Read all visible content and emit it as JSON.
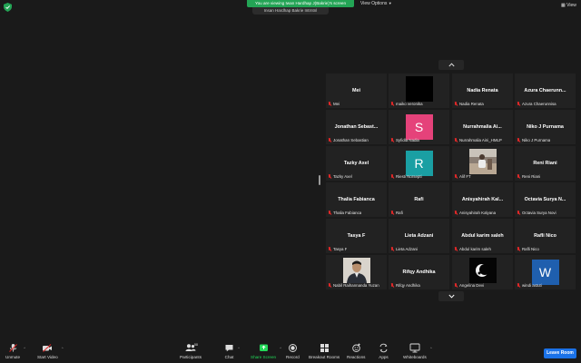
{
  "top_bar": {
    "banner_text": "You are viewing Iwan Hardhap J(Bakrie)'s screen",
    "view_options_label": "View Options",
    "view_label": "View",
    "shared_window_title": "Insan Hardhap Bakrie Intrntnl"
  },
  "colors": {
    "background": "#1a1a1a",
    "tile_background": "#222222",
    "banner_green": "#23a455",
    "share_green": "#23d959",
    "leave_blue": "#1b72e8",
    "muted_red": "#e02828"
  },
  "gallery": {
    "tiles": [
      {
        "name": "Mei",
        "label": "Mei",
        "avatar": "none"
      },
      {
        "name": "",
        "label": "maiko veronika",
        "avatar": "black-video"
      },
      {
        "name": "Nadia Renata",
        "label": "Nadia Renata",
        "avatar": "none"
      },
      {
        "name": "Azura Chaerunn...",
        "label": "Azura Chaerunnisa",
        "avatar": "none"
      },
      {
        "name": "Jonathan Sebast...",
        "label": "Jonathan Sebastian",
        "avatar": "none"
      },
      {
        "name": "",
        "label": "Syfidla Nadia",
        "avatar": "letter",
        "letter": "S",
        "color": "#e5427a"
      },
      {
        "name": "Nurrahmalia Ai...",
        "label": "Nurrahmalia Aini_HMLP",
        "avatar": "none"
      },
      {
        "name": "Niko J Purnama",
        "label": "Niko J Purnama",
        "avatar": "none"
      },
      {
        "name": "Tazky Axel",
        "label": "Tazky Axel",
        "avatar": "none"
      },
      {
        "name": "",
        "label": "Riesti Norsepti",
        "avatar": "letter",
        "letter": "R",
        "color": "#1a9fa3"
      },
      {
        "name": "",
        "label": "Alif FT",
        "avatar": "photo-outdoor"
      },
      {
        "name": "Reni Riani",
        "label": "Reni Riani",
        "avatar": "none"
      },
      {
        "name": "Thalia Fabianca",
        "label": "Thalia Fabianca",
        "avatar": "none"
      },
      {
        "name": "Rafi",
        "label": "Rafi",
        "avatar": "none"
      },
      {
        "name": "Anisyahirah Kal...",
        "label": "Anisyahirah Kalyana",
        "avatar": "none"
      },
      {
        "name": "Octavia Surya N...",
        "label": "Octavia Surya Novi",
        "avatar": "none"
      },
      {
        "name": "Tasya F",
        "label": "Tasya F",
        "avatar": "none"
      },
      {
        "name": "Lieta Adzani",
        "label": "Lieta Adzani",
        "avatar": "none"
      },
      {
        "name": "Abdul karim saleh",
        "label": "Abdul karim saleh",
        "avatar": "none"
      },
      {
        "name": "Rafli Nico",
        "label": "Rafli Nico",
        "avatar": "none"
      },
      {
        "name": "",
        "label": "Nabil Raihannanda Yuzan",
        "avatar": "photo-portrait"
      },
      {
        "name": "Rifqy Andhika",
        "label": "Rifqy Andhika",
        "avatar": "none"
      },
      {
        "name": "",
        "label": "Angelina Devi",
        "avatar": "photo-dark"
      },
      {
        "name": "",
        "label": "windi astuti",
        "avatar": "letter-w",
        "letter": "W",
        "color": "#1f5fae"
      }
    ]
  },
  "toolbar": {
    "unmute": "Unmute",
    "start_video": "Start Video",
    "participants": "Participants",
    "participants_count": "58",
    "chat": "Chat",
    "share_screen": "Share Screen",
    "record": "Record",
    "breakout_rooms": "Breakout Rooms",
    "reactions": "Reactions",
    "apps": "Apps",
    "whiteboards": "Whiteboards",
    "leave": "Leave Room"
  }
}
